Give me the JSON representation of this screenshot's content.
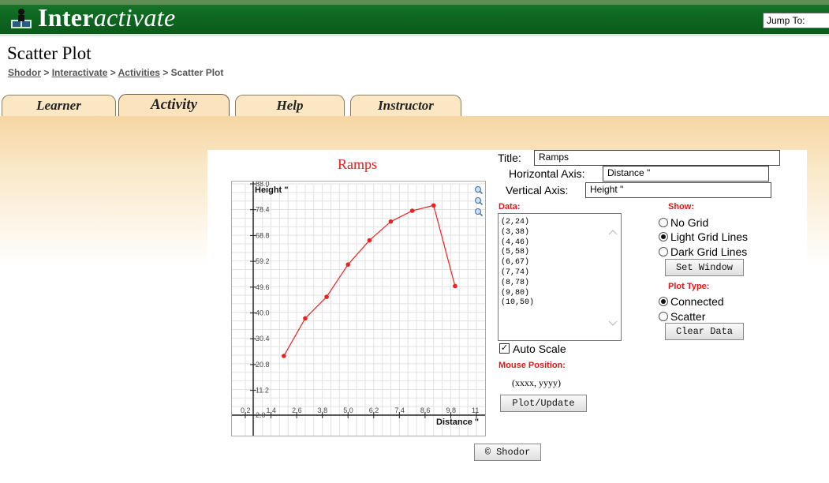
{
  "header": {
    "logo_main": "Inter",
    "logo_italic": "activate",
    "jump_to": "Jump To:"
  },
  "page_title": "Scatter Plot",
  "breadcrumb": [
    {
      "label": "Shodor",
      "link": true
    },
    {
      "label": "Interactivate",
      "link": true
    },
    {
      "label": "Activities",
      "link": true
    },
    {
      "label": "Scatter Plot",
      "link": false
    }
  ],
  "breadcrumb_sep": " > ",
  "tabs": [
    {
      "label": "Learner",
      "active": false
    },
    {
      "label": "Activity",
      "active": true
    },
    {
      "label": "Help",
      "active": false
    },
    {
      "label": "Instructor",
      "active": false
    }
  ],
  "form": {
    "title_label": "Title:",
    "title_value": "Ramps",
    "haxis_label": "Horizontal Axis:",
    "haxis_value": "Distance \"",
    "vaxis_label": "Vertical Axis:",
    "vaxis_value": "Height \"",
    "data_label": "Data:",
    "data_lines": [
      "(2,24)",
      "(3,38)",
      "(4,46)",
      "(5,58)",
      "(6,67)",
      "(7,74)",
      "(8,78)",
      "(9,80)",
      "(10,50)"
    ],
    "show_label": "Show:",
    "show_options": [
      {
        "label": "No Grid",
        "checked": false
      },
      {
        "label": "Light Grid Lines",
        "checked": true
      },
      {
        "label": "Dark Grid Lines",
        "checked": false
      }
    ],
    "set_window": "Set Window",
    "plot_type_label": "Plot Type:",
    "plot_options": [
      {
        "label": "Connected",
        "checked": true
      },
      {
        "label": "Scatter",
        "checked": false
      }
    ],
    "clear_data": "Clear Data",
    "auto_scale_label": "Auto Scale",
    "auto_scale_checked": true,
    "mouse_label": "Mouse Position:",
    "mouse_value": "(xxxx, yyyy)",
    "plot_button": "Plot/Update"
  },
  "footer_button": "© Shodor",
  "chart_data": {
    "type": "line",
    "title": "Ramps",
    "xlabel": "Distance \"",
    "ylabel": "Height \"",
    "x": [
      2,
      3,
      4,
      5,
      6,
      7,
      8,
      9,
      10
    ],
    "values": [
      24,
      38,
      46,
      58,
      67,
      74,
      78,
      80,
      50
    ],
    "xlim": [
      0.2,
      11
    ],
    "ylim": [
      2.0,
      88.0
    ],
    "x_ticks": [
      "0.2",
      "1.4",
      "2.6",
      "3.8",
      "5.0",
      "6.2",
      "7.4",
      "8.6",
      "9.8",
      "11"
    ],
    "y_ticks": [
      "2.0",
      "11.2",
      "20.8",
      "30.4",
      "40.0",
      "49.6",
      "59.2",
      "68.8",
      "78.4",
      "88.0"
    ],
    "grid": "light",
    "color": "#ee2020"
  }
}
